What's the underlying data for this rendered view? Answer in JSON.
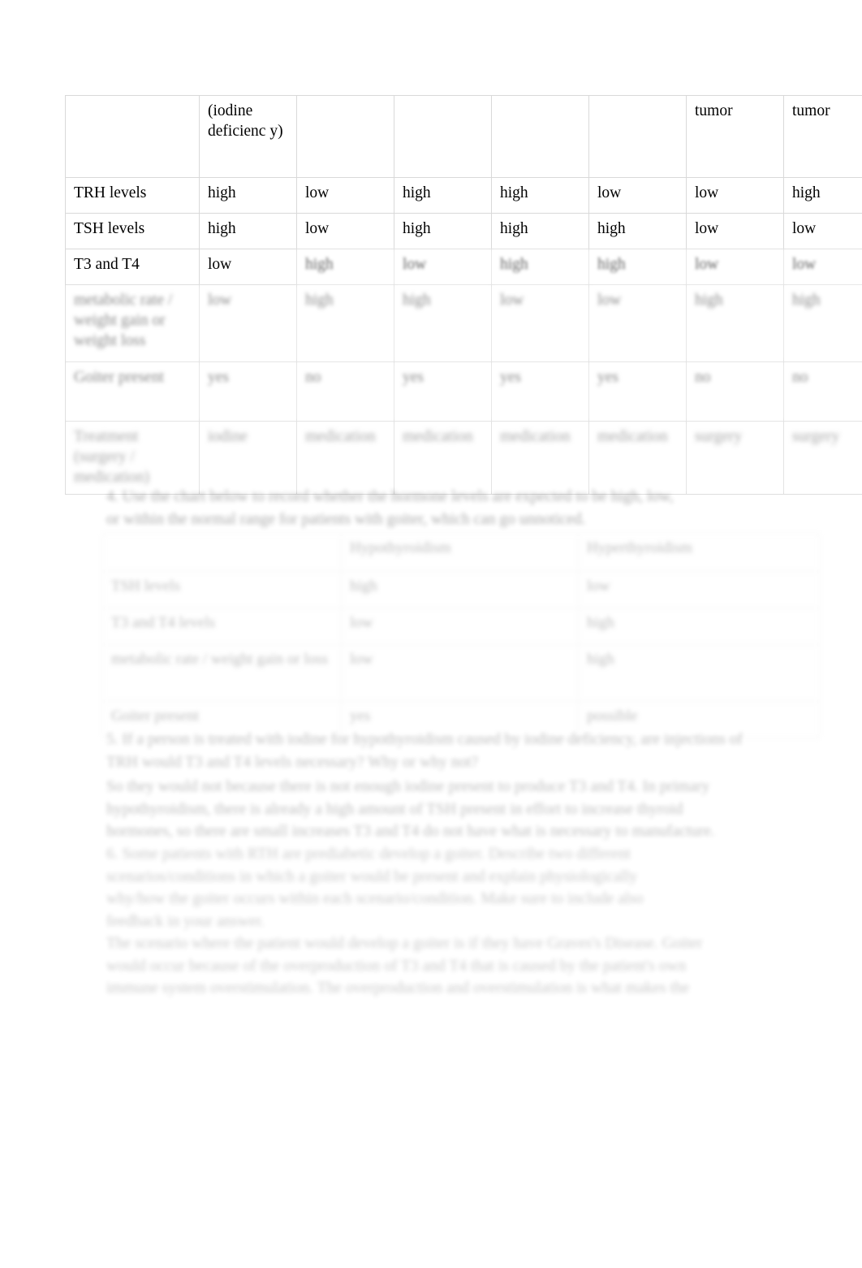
{
  "document": {
    "page_background": "#ffffff",
    "text_color": "#000000",
    "table_border_color": "#d9d9d9"
  },
  "table_one": {
    "name": "thyroid-conditions-comparison-table",
    "header_row": {
      "label": "",
      "cells": [
        "(iodine deficienc y)",
        "",
        "",
        "",
        "",
        "tumor",
        "tumor"
      ]
    },
    "rows": [
      {
        "label": "TRH levels",
        "cells": [
          "high",
          "low",
          "high",
          "high",
          "low",
          "low",
          "high"
        ]
      },
      {
        "label": "TSH levels",
        "cells": [
          "high",
          "low",
          "high",
          "high",
          "high",
          "low",
          "low"
        ]
      },
      {
        "label": "T3 and T4",
        "cells": [
          "low",
          "high",
          "low",
          "high",
          "high",
          "low",
          "low"
        ]
      },
      {
        "label": "metabolic rate / weight gain or weight loss",
        "cells": [
          "low",
          "high",
          "high",
          "low",
          "low",
          "high",
          "high"
        ]
      },
      {
        "label": "Goiter present",
        "cells": [
          "yes",
          "no",
          "yes",
          "yes",
          "yes",
          "no",
          "no"
        ]
      },
      {
        "label": "Treatment (surgery / medication)",
        "cells": [
          "iodine",
          "medication",
          "medication",
          "medication",
          "medication",
          "surgery",
          "surgery"
        ]
      }
    ]
  },
  "paragraph_a": {
    "line_1": "4. Use the chart below to record whether the hormone levels are expected to be high, low,",
    "line_2": "or within the normal range for patients with goiter, which can go unnoticed."
  },
  "table_two": {
    "name": "hypothyroidism-hyperthyroidism-table",
    "header_row": {
      "label": "",
      "cells": [
        "Hypothyroidism",
        "Hyperthyroidism"
      ]
    },
    "rows": [
      {
        "label": "TSH levels",
        "cells": [
          "high",
          "low"
        ]
      },
      {
        "label": "T3 and T4 levels",
        "cells": [
          "low",
          "high"
        ]
      },
      {
        "label": "metabolic rate / weight gain or loss",
        "cells": [
          "low",
          "high"
        ]
      },
      {
        "label": "Goiter present",
        "cells": [
          "yes",
          "possible"
        ]
      }
    ]
  },
  "paragraph_b": {
    "line_1": "5. If a person is treated with iodine for hypothyroidism caused by iodine deficiency, are injections of",
    "line_2": "TRH would T3 and T4 levels necessary? Why or why not?"
  },
  "paragraph_c": {
    "line_1": "So they would not because there is not enough iodine present to produce T3 and T4. In primary",
    "line_2": "hypothyroidism, there is already a high amount of TSH present in effort to increase thyroid",
    "line_3": "hormones, so there are small increases T3 and T4 do not have what is necessary to manufacture."
  },
  "paragraph_d": {
    "line_1": "6. Some patients with RTH are prediabetic develop a goiter. Describe two different",
    "line_2": "scenarios/conditions in which a goiter would be present and explain physiologically",
    "line_3": "why/how the goiter occurs within each scenario/condition. Make sure to include also",
    "line_4": "feedback in your answer."
  },
  "paragraph_e": {
    "line_1": "The scenario where the patient would develop a goiter is if they have Graves's Disease. Goiter",
    "line_2": "would occur because of the overproduction of T3 and T4 that is caused by the patient's own",
    "line_3": "immune system overstimulation. The overproduction and overstimulation is what makes the"
  }
}
